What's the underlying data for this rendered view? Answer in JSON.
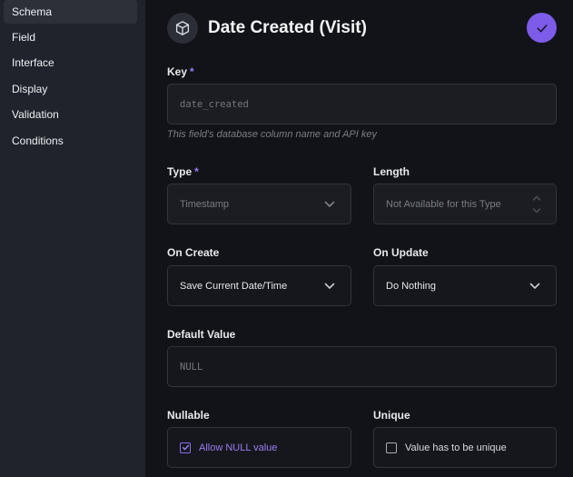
{
  "sidebar": {
    "items": [
      {
        "label": "Schema",
        "active": true
      },
      {
        "label": "Field"
      },
      {
        "label": "Interface"
      },
      {
        "label": "Display"
      },
      {
        "label": "Validation"
      },
      {
        "label": "Conditions"
      }
    ]
  },
  "header": {
    "icon": "cube-icon",
    "title": "Date Created (Visit)",
    "save_icon": "check-icon",
    "accent_color": "#7c5ce8"
  },
  "form": {
    "key": {
      "label": "Key",
      "required_mark": "*",
      "value": "date_created",
      "hint": "This field's database column name and API key"
    },
    "type": {
      "label": "Type",
      "required_mark": "*",
      "value": "Timestamp"
    },
    "length": {
      "label": "Length",
      "placeholder": "Not Available for this Type"
    },
    "on_create": {
      "label": "On Create",
      "value": "Save Current Date/Time"
    },
    "on_update": {
      "label": "On Update",
      "value": "Do Nothing"
    },
    "default_value": {
      "label": "Default Value",
      "placeholder": "NULL"
    },
    "nullable": {
      "label": "Nullable",
      "checkbox_label": "Allow NULL value",
      "checked": true
    },
    "unique": {
      "label": "Unique",
      "checkbox_label": "Value has to be unique",
      "checked": false
    }
  }
}
